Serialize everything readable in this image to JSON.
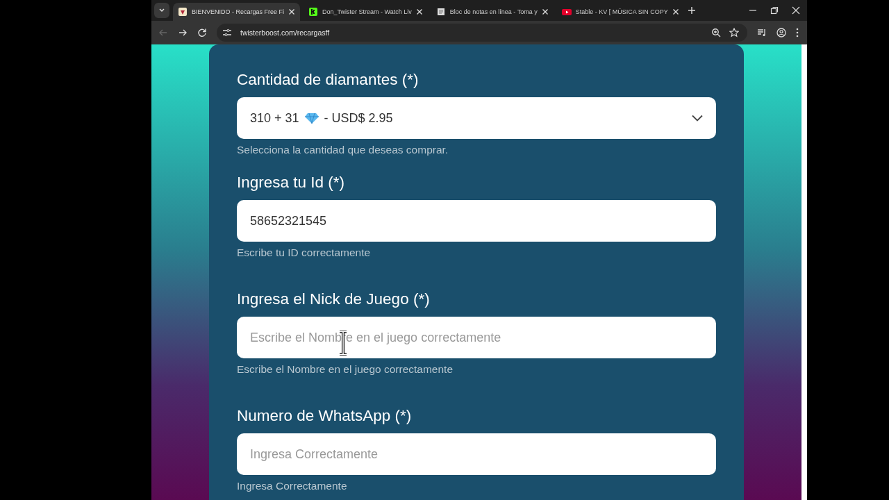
{
  "browser": {
    "tabs": [
      {
        "title": "BIENVENIDO - Recargas Free Fi",
        "selected": true,
        "kind": "heart"
      },
      {
        "title": "Don_Twister Stream - Watch Liv",
        "selected": false,
        "kind": "kick"
      },
      {
        "title": "Bloc de notas en línea - Toma y",
        "selected": false,
        "kind": "notepad"
      },
      {
        "title": "Stable - KV [ MÚSICA SIN COPY",
        "selected": false,
        "kind": "youtube"
      }
    ],
    "url": "twisterboost.com/recargasff"
  },
  "form": {
    "fields": [
      {
        "kind": "select",
        "label": "Cantidad de diamantes (*)",
        "value_prefix": "310 + 31",
        "value_suffix": "- USD$ 2.95",
        "hint": "Selecciona la cantidad que deseas comprar."
      },
      {
        "kind": "input",
        "label": "Ingresa tu Id (*)",
        "value": "58652321545",
        "hint": "Escribe tu ID correctamente"
      },
      {
        "kind": "input",
        "label": "Ingresa el Nick de Juego (*)",
        "placeholder": "Escribe el Nombre en el juego correctamente",
        "hint": "Escribe el Nombre en el juego correctamente",
        "cursor": true
      },
      {
        "kind": "input",
        "label": "Numero de WhatsApp (*)",
        "placeholder": "Ingresa Correctamente",
        "hint": "Ingresa Correctamente"
      }
    ]
  }
}
